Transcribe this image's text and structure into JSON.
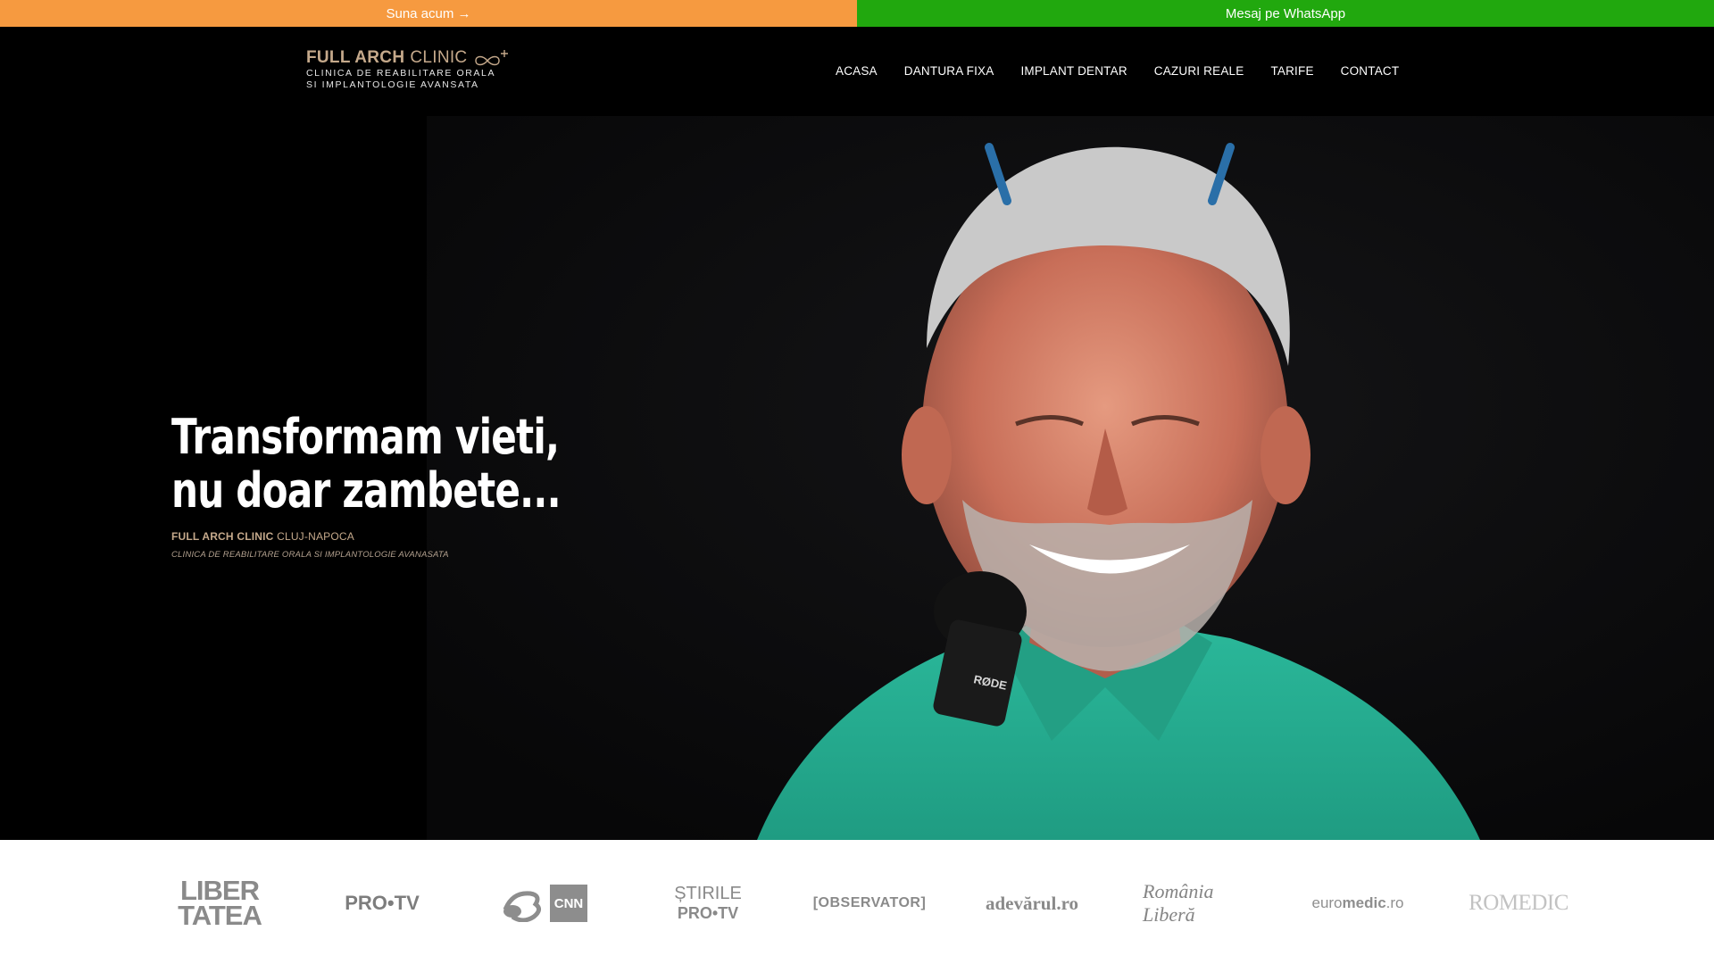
{
  "cta": {
    "call_label": "Suna acum →",
    "whatsapp_label": "Mesaj pe WhatsApp",
    "call_color": "#f69a40",
    "whatsapp_color": "#21a80e"
  },
  "logo": {
    "name_bold": "FULL ARCH",
    "name_light": "CLINIC",
    "tagline_line1": "CLINICA DE REABILITARE ORALA",
    "tagline_line2": "SI IMPLANTOLOGIE AVANSATA",
    "accent_color": "#c5a98b"
  },
  "nav": {
    "items": [
      "ACASA",
      "DANTURA FIXA",
      "IMPLANT DENTAR",
      "CAZURI REALE",
      "TARIFE",
      "CONTACT"
    ]
  },
  "hero": {
    "title_line1": "Transformam vieti,",
    "title_line2": "nu doar zambete...",
    "clinic_bold": "FULL ARCH CLINIC",
    "clinic_city": "CLUJ-NAPOCA",
    "subtitle": "CLINICA DE REABILITARE ORALA SI IMPLANTOLOGIE AVANASATA",
    "image": "smiling-patient-photo",
    "mic_label": "RØDE"
  },
  "press": {
    "libertatea_line1": "LIBER",
    "libertatea_line2": "TATEA",
    "protv": "PRO•TV",
    "cnn": "CNN",
    "stirile_line1": "ȘTIRILE",
    "stirile_line2": "PRO•TV",
    "observator": "[OBSERVATOR]",
    "adevarul": "adevărul.ro",
    "romania_libera": "România Liberă",
    "euromedic_light": "euro",
    "euromedic_bold": "medic",
    "euromedic_suffix": ".ro",
    "romedic": "ROMEDIC"
  }
}
